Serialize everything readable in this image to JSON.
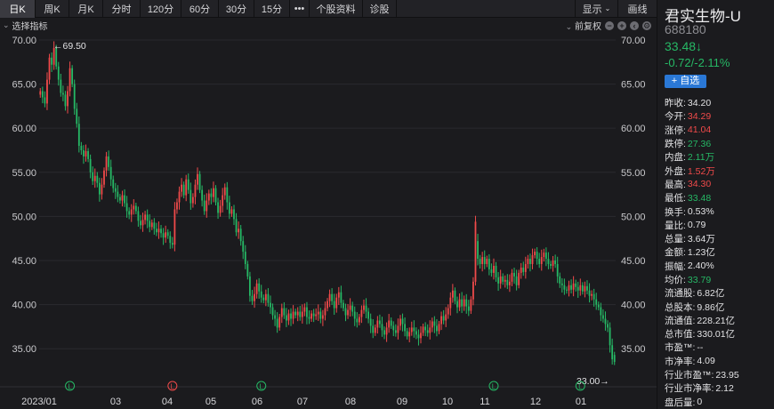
{
  "toolbar": {
    "tabs": [
      {
        "label": "日K",
        "active": true
      },
      {
        "label": "周K",
        "active": false
      },
      {
        "label": "月K",
        "active": false
      },
      {
        "label": "分时",
        "active": false
      },
      {
        "label": "120分",
        "active": false
      },
      {
        "label": "60分",
        "active": false
      },
      {
        "label": "30分",
        "active": false
      },
      {
        "label": "15分",
        "active": false
      },
      {
        "label": "•••",
        "active": false
      },
      {
        "label": "个股资料",
        "active": false
      },
      {
        "label": "诊股",
        "active": false
      }
    ],
    "display_label": "显示",
    "draw_label": "画线"
  },
  "indicator_bar": {
    "select_label": "选择指标",
    "adjust_label": "前复权"
  },
  "stock": {
    "name": "君实生物-U",
    "code": "688180",
    "price": "33.48",
    "price_arrow": "↓",
    "change": "-0.72/-2.11%",
    "add_watch_label": "+ 自选"
  },
  "stats": [
    {
      "label": "昨收:",
      "value": "34.20",
      "color": "neutral"
    },
    {
      "label": "今开:",
      "value": "34.29",
      "color": "red"
    },
    {
      "label": "涨停:",
      "value": "41.04",
      "color": "red"
    },
    {
      "label": "跌停:",
      "value": "27.36",
      "color": "green"
    },
    {
      "label": "内盘:",
      "value": "2.11万",
      "color": "green"
    },
    {
      "label": "外盘:",
      "value": "1.52万",
      "color": "red"
    },
    {
      "label": "最高:",
      "value": "34.30",
      "color": "red"
    },
    {
      "label": "最低:",
      "value": "33.48",
      "color": "green"
    },
    {
      "label": "换手:",
      "value": "0.53%",
      "color": "neutral"
    },
    {
      "label": "量比:",
      "value": "0.79",
      "color": "neutral"
    },
    {
      "label": "总量:",
      "value": "3.64万",
      "color": "neutral"
    },
    {
      "label": "金额:",
      "value": "1.23亿",
      "color": "neutral"
    },
    {
      "label": "振幅:",
      "value": "2.40%",
      "color": "neutral"
    },
    {
      "label": "均价:",
      "value": "33.79",
      "color": "green"
    },
    {
      "label": "流通股:",
      "value": "6.82亿",
      "color": "neutral"
    },
    {
      "label": "总股本:",
      "value": "9.86亿",
      "color": "neutral"
    },
    {
      "label": "流通值:",
      "value": "228.21亿",
      "color": "neutral"
    },
    {
      "label": "总市值:",
      "value": "330.01亿",
      "color": "neutral"
    },
    {
      "label": "市盈™:",
      "value": "--",
      "color": "neutral"
    },
    {
      "label": "市净率:",
      "value": "4.09",
      "color": "neutral"
    },
    {
      "label": "行业市盈™:",
      "value": "23.95",
      "color": "neutral"
    },
    {
      "label": "行业市净率:",
      "value": "2.12",
      "color": "neutral"
    },
    {
      "label": "盘后量:",
      "value": "0",
      "color": "neutral"
    }
  ],
  "colors": {
    "up": "#f04a4a",
    "down": "#26b865",
    "accent": "#2a78d6"
  },
  "chart_data": {
    "type": "candlestick",
    "y_ticks": [
      "70.00",
      "65.00",
      "60.00",
      "55.00",
      "50.00",
      "45.00",
      "40.00",
      "35.00"
    ],
    "ylim": [
      32.0,
      70.5
    ],
    "x_tick_labels": [
      "2023/01",
      "03",
      "04",
      "05",
      "06",
      "07",
      "08",
      "09",
      "10",
      "11",
      "12",
      "01"
    ],
    "annotations": {
      "high": "←69.50",
      "low": "33.00→"
    },
    "markers": [
      {
        "label": "L",
        "color": "green",
        "index": 13
      },
      {
        "label": "L",
        "color": "red",
        "index": 58
      },
      {
        "label": "L",
        "color": "green",
        "index": 97
      },
      {
        "label": "L",
        "color": "green",
        "index": 199
      },
      {
        "label": "L",
        "color": "green",
        "index": 237
      }
    ],
    "close": [
      64.2,
      63.5,
      62.8,
      65.5,
      68.0,
      67.2,
      69.1,
      67.0,
      65.5,
      64.0,
      63.8,
      62.5,
      64.2,
      66.8,
      65.0,
      62.2,
      60.5,
      58.0,
      57.5,
      56.8,
      57.4,
      56.5,
      55.0,
      54.0,
      54.6,
      53.8,
      52.5,
      53.6,
      55.2,
      56.8,
      55.6,
      54.2,
      53.2,
      52.8,
      52.2,
      51.8,
      52.4,
      51.5,
      50.6,
      50.2,
      50.8,
      51.2,
      50.6,
      49.5,
      49.0,
      49.6,
      50.2,
      49.5,
      48.8,
      49.3,
      48.6,
      48.2,
      48.6,
      48.1,
      47.6,
      48.2,
      47.8,
      47.0,
      46.8,
      50.8,
      51.6,
      52.8,
      53.6,
      52.4,
      54.2,
      53.0,
      51.5,
      52.2,
      53.6,
      54.8,
      53.0,
      51.8,
      50.6,
      51.8,
      52.6,
      52.2,
      53.2,
      51.6,
      50.4,
      51.2,
      52.4,
      53.3,
      51.6,
      50.3,
      50.8,
      49.7,
      48.2,
      48.6,
      47.2,
      46.0,
      44.6,
      43.2,
      41.0,
      40.4,
      41.2,
      42.4,
      41.5,
      40.8,
      40.5,
      41.2,
      40.2,
      39.7,
      38.8,
      38.4,
      37.4,
      38.6,
      39.6,
      38.8,
      38.2,
      39.0,
      38.4,
      39.2,
      38.8,
      39.2,
      38.6,
      39.2,
      39.7,
      38.6,
      38.4,
      39.0,
      38.7,
      38.9,
      39.2,
      38.4,
      38.8,
      39.6,
      40.4,
      41.2,
      40.4,
      39.6,
      40.8,
      41.4,
      40.2,
      39.6,
      38.8,
      39.4,
      39.9,
      39.2,
      38.4,
      38.0,
      38.6,
      39.4,
      39.9,
      39.2,
      38.4,
      37.6,
      36.8,
      37.4,
      38.2,
      37.8,
      37.1,
      36.6,
      37.4,
      38.2,
      37.6,
      37.1,
      36.8,
      37.6,
      38.4,
      37.8,
      37.0,
      36.4,
      36.9,
      37.4,
      37.0,
      36.6,
      36.2,
      36.8,
      37.5,
      37.1,
      36.8,
      37.4,
      38.1,
      37.6,
      37.0,
      37.8,
      38.7,
      38.2,
      38.9,
      39.6,
      40.8,
      41.6,
      40.4,
      39.7,
      40.6,
      39.8,
      40.6,
      39.8,
      39.3,
      40.6,
      42.6,
      49.4,
      45.2,
      44.6,
      45.4,
      44.6,
      45.2,
      44.0,
      43.6,
      44.4,
      43.1,
      42.4,
      43.2,
      42.6,
      42.8,
      42.2,
      42.6,
      43.6,
      43.2,
      42.2,
      43.6,
      44.2,
      43.7,
      44.6,
      45.2,
      44.6,
      45.6,
      46.0,
      45.2,
      44.6,
      45.4,
      45.9,
      45.2,
      44.6,
      44.4,
      45.0,
      44.6,
      43.2,
      42.4,
      42.2,
      41.7,
      41.6,
      42.2,
      41.7,
      42.4,
      42.0,
      41.6,
      42.2,
      41.5,
      42.1,
      41.6,
      41.0,
      41.2,
      40.6,
      40.0,
      39.7,
      38.8,
      38.4,
      37.8,
      37.4,
      35.4,
      33.8,
      33.5
    ],
    "open": [
      63.8,
      64.2,
      63.5,
      62.8,
      65.5,
      68.0,
      67.2,
      69.1,
      67.0,
      65.5,
      64.0,
      63.8,
      62.5,
      64.2,
      66.8,
      65.0,
      62.2,
      60.5,
      58.0,
      57.5,
      56.8,
      57.4,
      56.5,
      55.0,
      54.0,
      54.6,
      53.8,
      52.5,
      53.6,
      55.2,
      56.8,
      55.6,
      54.2,
      53.2,
      52.8,
      52.2,
      51.8,
      52.4,
      51.5,
      50.6,
      50.2,
      50.8,
      51.2,
      50.6,
      49.5,
      49.0,
      49.6,
      50.2,
      49.5,
      48.8,
      49.3,
      48.6,
      48.2,
      48.6,
      48.1,
      47.6,
      48.2,
      47.8,
      47.0,
      46.8,
      50.8,
      51.6,
      52.8,
      53.6,
      52.4,
      54.2,
      53.0,
      51.5,
      52.2,
      53.6,
      54.8,
      53.0,
      51.8,
      50.6,
      51.8,
      52.6,
      52.2,
      53.2,
      51.6,
      50.4,
      51.2,
      52.4,
      53.3,
      51.6,
      50.3,
      50.8,
      49.7,
      48.2,
      48.6,
      47.2,
      46.0,
      44.6,
      43.2,
      41.0,
      40.4,
      41.2,
      42.4,
      41.5,
      40.8,
      40.5,
      41.2,
      40.2,
      39.7,
      38.8,
      38.4,
      37.4,
      38.6,
      39.6,
      38.8,
      38.2,
      39.0,
      38.4,
      39.2,
      38.8,
      39.2,
      38.6,
      39.2,
      39.7,
      38.6,
      38.4,
      39.0,
      38.7,
      38.9,
      39.2,
      38.4,
      38.8,
      39.6,
      40.4,
      41.2,
      40.4,
      39.6,
      40.8,
      41.4,
      40.2,
      39.6,
      38.8,
      39.4,
      39.9,
      39.2,
      38.4,
      38.0,
      38.6,
      39.4,
      39.9,
      39.2,
      38.4,
      37.6,
      36.8,
      37.4,
      38.2,
      37.8,
      37.1,
      36.6,
      37.4,
      38.2,
      37.6,
      37.1,
      36.8,
      37.6,
      38.4,
      37.8,
      37.0,
      36.4,
      36.9,
      37.4,
      37.0,
      36.6,
      36.2,
      36.8,
      37.5,
      37.1,
      36.8,
      37.4,
      38.1,
      37.6,
      37.0,
      37.8,
      38.7,
      38.2,
      38.9,
      39.6,
      40.8,
      41.6,
      40.4,
      39.7,
      40.6,
      39.8,
      40.6,
      39.8,
      39.3,
      40.6,
      42.6,
      47.2,
      45.2,
      44.6,
      45.4,
      44.6,
      45.2,
      44.0,
      43.6,
      44.4,
      43.1,
      42.4,
      43.2,
      42.6,
      42.8,
      42.2,
      42.6,
      43.6,
      43.2,
      42.2,
      43.6,
      44.2,
      43.7,
      44.6,
      45.2,
      44.6,
      45.6,
      46.0,
      45.2,
      44.6,
      45.4,
      45.9,
      45.2,
      44.6,
      44.4,
      45.0,
      44.6,
      43.2,
      42.4,
      42.2,
      41.7,
      41.6,
      42.2,
      41.7,
      42.4,
      42.0,
      41.6,
      42.2,
      41.5,
      42.1,
      41.6,
      41.0,
      41.2,
      40.6,
      40.0,
      39.7,
      38.8,
      38.4,
      37.8,
      37.4,
      35.4,
      34.3
    ]
  }
}
